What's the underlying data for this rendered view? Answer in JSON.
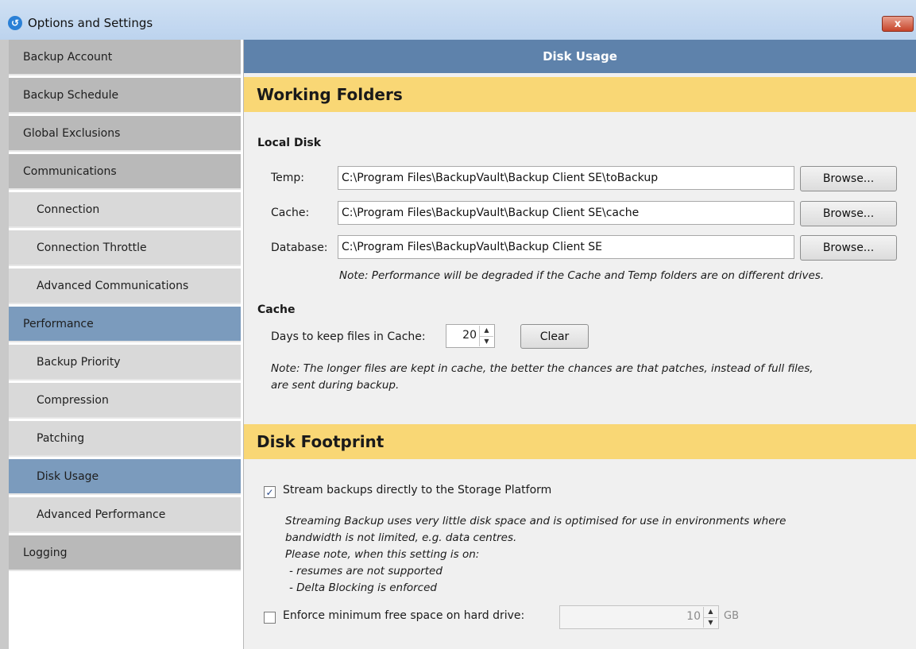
{
  "window": {
    "title": "Options and Settings",
    "app_icon": "backupvault-logo-icon",
    "close_glyph": "x"
  },
  "sidebar": {
    "items": [
      {
        "label": "Backup Account"
      },
      {
        "label": "Backup Schedule"
      },
      {
        "label": "Global Exclusions"
      },
      {
        "label": "Communications"
      },
      {
        "label": "Connection"
      },
      {
        "label": "Connection Throttle"
      },
      {
        "label": "Advanced Communications"
      },
      {
        "label": "Performance"
      },
      {
        "label": "Backup Priority"
      },
      {
        "label": "Compression"
      },
      {
        "label": "Patching"
      },
      {
        "label": "Disk Usage"
      },
      {
        "label": "Advanced Performance"
      },
      {
        "label": "Logging"
      }
    ],
    "selected": "Disk Usage"
  },
  "main": {
    "header": "Disk Usage",
    "working_folders": {
      "title": "Working Folders",
      "local_disk": "Local Disk",
      "temp": {
        "label": "Temp:",
        "value": "C:\\Program Files\\BackupVault\\Backup Client SE\\toBackup",
        "browse": "Browse..."
      },
      "cache": {
        "label": "Cache:",
        "value": "C:\\Program Files\\BackupVault\\Backup Client SE\\cache",
        "browse": "Browse..."
      },
      "database": {
        "label": "Database:",
        "value": "C:\\Program Files\\BackupVault\\Backup Client SE",
        "browse": "Browse..."
      },
      "note": "Note: Performance will be degraded if the Cache and Temp folders are on different drives."
    },
    "cache_section": {
      "title": "Cache",
      "days_label": "Days to keep files in Cache:",
      "days_value": "20",
      "clear": "Clear",
      "note_line1": "Note: The longer files are kept in cache, the better the chances are that patches, instead of full files,",
      "note_line2": "are sent during backup."
    },
    "disk_footprint": {
      "title": "Disk Footprint",
      "stream_label": "Stream backups directly to the Storage Platform",
      "stream_checked": true,
      "desc": [
        "Streaming Backup uses very little disk space and is optimised for use in environments where",
        "bandwidth is not limited, e.g. data centres.",
        "Please note, when this setting is on:",
        "  - resumes are not supported",
        "  - Delta Blocking is enforced"
      ],
      "enforce_label": "Enforce minimum free space on hard drive:",
      "enforce_checked": false,
      "min_space_value": "10",
      "min_space_unit": "GB"
    }
  },
  "colors": {
    "header": "#5e82ab",
    "section_band": "#f9d775",
    "selected_nav": "#7b9bbd"
  }
}
